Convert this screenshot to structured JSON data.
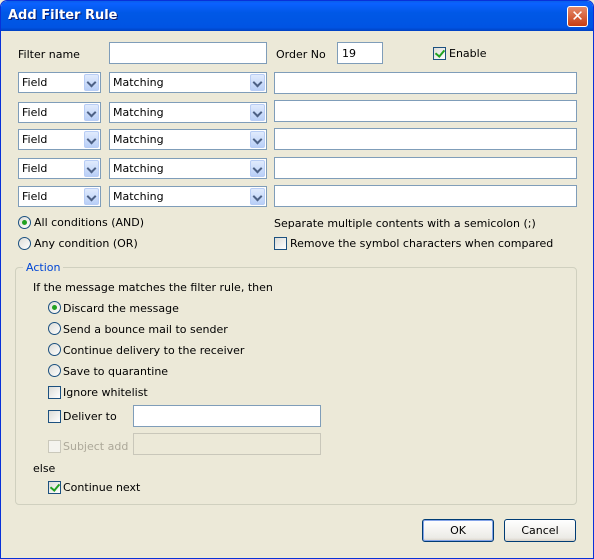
{
  "window": {
    "title": "Add Filter Rule",
    "close_glyph": "✕"
  },
  "filter_name": {
    "label": "Filter name",
    "value": ""
  },
  "order_no": {
    "label": "Order No",
    "value": "19"
  },
  "enable": {
    "label": "Enable",
    "checked": true
  },
  "conditions": [
    {
      "field": "Field",
      "matching": "Matching",
      "content": ""
    },
    {
      "field": "Field",
      "matching": "Matching",
      "content": ""
    },
    {
      "field": "Field",
      "matching": "Matching",
      "content": ""
    },
    {
      "field": "Field",
      "matching": "Matching",
      "content": ""
    },
    {
      "field": "Field",
      "matching": "Matching",
      "content": ""
    }
  ],
  "logic": {
    "all_label": "All conditions (AND)",
    "any_label": "Any condition (OR)",
    "selected": "all"
  },
  "separator_hint": "Separate multiple contents with a semicolon (;)",
  "remove_symbols": {
    "label": "Remove the symbol characters when compared",
    "checked": false
  },
  "action": {
    "legend": "Action",
    "intro": "If the message matches the filter rule, then",
    "options": [
      "Discard the message",
      "Send a bounce mail to sender",
      "Continue delivery to the receiver",
      "Save to quarantine"
    ],
    "selected_index": 0,
    "ignore_whitelist": {
      "label": "Ignore whitelist",
      "checked": false
    },
    "deliver_to": {
      "label": "Deliver to",
      "checked": false,
      "value": ""
    },
    "subject_add": {
      "label": "Subject add",
      "checked": false,
      "enabled": false,
      "value": ""
    },
    "else_label": "else",
    "continue_next": {
      "label": "Continue next",
      "checked": true
    }
  },
  "buttons": {
    "ok": "OK",
    "cancel": "Cancel"
  }
}
